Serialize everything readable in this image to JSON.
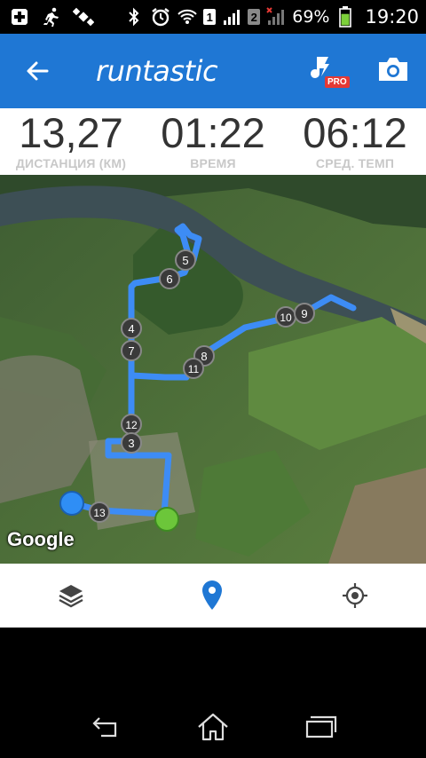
{
  "status_bar": {
    "icons": [
      "plus-box-icon",
      "running-person-icon",
      "satellite-icon",
      "bluetooth-icon",
      "alarm-clock-icon",
      "wifi-icon",
      "signal-icon",
      "signal-no-service-icon",
      "battery-icon"
    ],
    "sim1_label": "1",
    "sim2_label": "2",
    "battery_percent": "69%",
    "battery_level": 0.69,
    "time": "19:20"
  },
  "app_bar": {
    "logo_text": "runtastic",
    "music_badge": "PRO",
    "icons": [
      "back-arrow-icon",
      "music-note-icon",
      "camera-icon"
    ]
  },
  "stats": [
    {
      "value": "13,27",
      "label": "ДИСТАНЦИЯ (КМ)"
    },
    {
      "value": "01:22",
      "label": "ВРЕМЯ"
    },
    {
      "value": "06:12",
      "label": "СРЕД. ТЕМП"
    }
  ],
  "map": {
    "attribution": "Google",
    "route_color": "#3d8cf5",
    "start_color": "#2f8ef5",
    "end_color": "#6cc63a",
    "markers": [
      "3",
      "4",
      "5",
      "6",
      "7",
      "8",
      "9",
      "10",
      "11",
      "12",
      "13"
    ]
  },
  "toolbar": {
    "icons": [
      "layers-icon",
      "map-pin-icon",
      "my-location-icon"
    ],
    "active_color": "#1f77d4"
  },
  "nav_bar": {
    "icons": [
      "back-icon",
      "home-icon",
      "recent-apps-icon"
    ]
  }
}
